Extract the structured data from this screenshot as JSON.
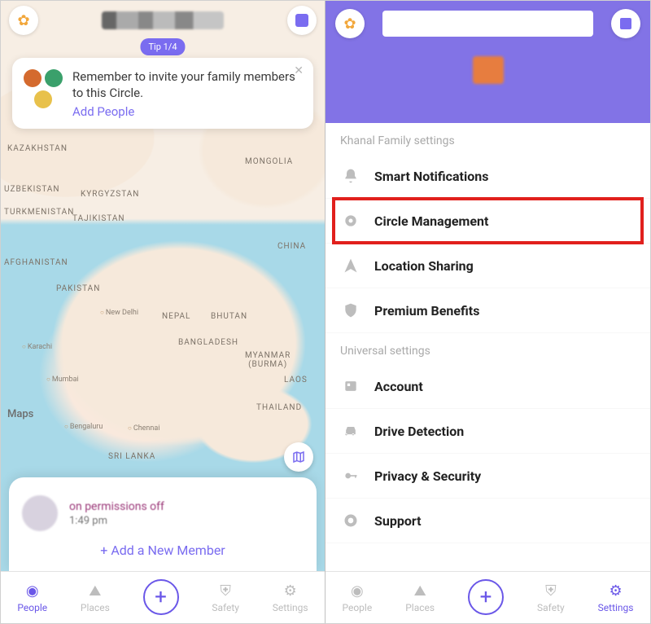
{
  "left": {
    "tip_badge": "Tip 1/4",
    "tip_text": "Remember to invite your family members to this Circle.",
    "add_people": "Add People",
    "maps_watermark": "Maps",
    "member_status": "on permissions off",
    "member_time": "1:49 pm",
    "add_member": "+ Add a New Member",
    "map": {
      "countries": {
        "kazakhstan": "KAZAKHSTAN",
        "mongolia": "MONGOLIA",
        "uzbekistan": "UZBEKISTAN",
        "kyrgyzstan": "KYRGYZSTAN",
        "turkmenistan": "TURKMENISTAN",
        "tajikistan": "TAJIKISTAN",
        "china": "CHINA",
        "afghanistan": "AFGHANISTAN",
        "pakistan": "PAKISTAN",
        "nepal": "NEPAL",
        "bhutan": "BHUTAN",
        "bangladesh": "BANGLADESH",
        "myanmar": "MYANMAR\n(BURMA)",
        "laos": "LAOS",
        "thailand": "THAILAND",
        "srilanka": "SRI LANKA"
      },
      "cities": {
        "newdelhi": "New Delhi",
        "karachi": "Karachi",
        "mumbai": "Mumbai",
        "bengaluru": "Bengaluru",
        "chennai": "Chennai"
      }
    }
  },
  "right": {
    "section1": "Khanal Family  settings",
    "smart_notifications": "Smart Notifications",
    "circle_management": "Circle Management",
    "location_sharing": "Location Sharing",
    "premium_benefits": "Premium Benefits",
    "section2": "Universal settings",
    "account": "Account",
    "drive_detection": "Drive Detection",
    "privacy_security": "Privacy & Security",
    "support": "Support"
  },
  "tabs": {
    "people": "People",
    "places": "Places",
    "safety": "Safety",
    "settings": "Settings"
  }
}
